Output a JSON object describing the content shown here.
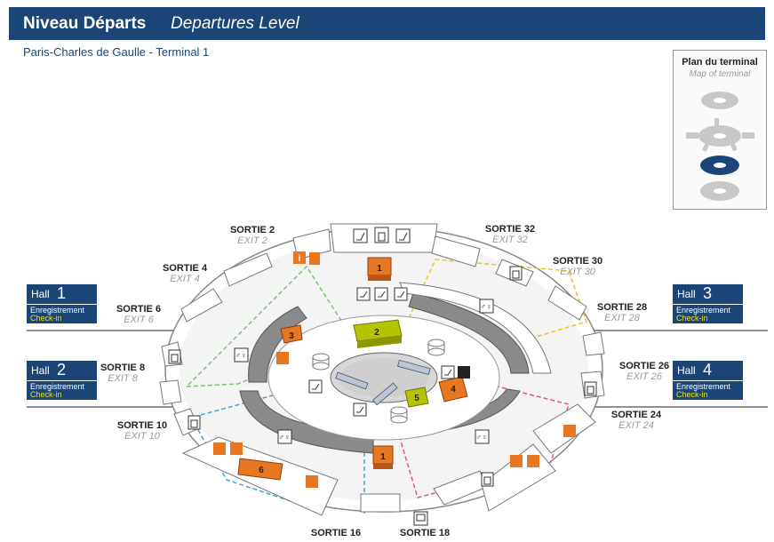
{
  "header": {
    "title_fr": "Niveau Départs",
    "title_en": "Departures Level"
  },
  "subtitle": "Paris-Charles de Gaulle - Terminal 1",
  "plan": {
    "title": "Plan du terminal",
    "subtitle": "Map of terminal"
  },
  "halls": [
    {
      "label": "Hall",
      "number": "1",
      "enregistrement": "Enregistrement",
      "checkin": "Check-in"
    },
    {
      "label": "Hall",
      "number": "2",
      "enregistrement": "Enregistrement",
      "checkin": "Check-in"
    },
    {
      "label": "Hall",
      "number": "3",
      "enregistrement": "Enregistrement",
      "checkin": "Check-in"
    },
    {
      "label": "Hall",
      "number": "4",
      "enregistrement": "Enregistrement",
      "checkin": "Check-in"
    }
  ],
  "exits": {
    "s2": {
      "fr": "SORTIE 2",
      "en": "EXIT 2"
    },
    "s4": {
      "fr": "SORTIE 4",
      "en": "EXIT 4"
    },
    "s6": {
      "fr": "SORTIE 6",
      "en": "EXIT 6"
    },
    "s8": {
      "fr": "SORTIE 8",
      "en": "EXIT 8"
    },
    "s10": {
      "fr": "SORTIE 10",
      "en": "EXIT 10"
    },
    "s16": {
      "fr": "SORTIE 16"
    },
    "s18": {
      "fr": "SORTIE 18"
    },
    "s24": {
      "fr": "SORTIE 24",
      "en": "EXIT 24"
    },
    "s26": {
      "fr": "SORTIE 26",
      "en": "EXIT 26"
    },
    "s28": {
      "fr": "SORTIE 28",
      "en": "EXIT 28"
    },
    "s30": {
      "fr": "SORTIE 30",
      "en": "EXIT 30"
    },
    "s32": {
      "fr": "SORTIE 32",
      "en": "EXIT 32"
    }
  },
  "zones": {
    "z1a": "1",
    "z1b": "1",
    "z2": "2",
    "z3": "3",
    "z4": "4",
    "z5": "5",
    "z6": "6"
  },
  "colors": {
    "navy": "#1b4576",
    "orange": "#e87722",
    "lime": "#b5c400",
    "yellow_path": "#f0c419",
    "green_path": "#7cc576",
    "blue_path": "#3aa8d8",
    "pink_path": "#e0509b",
    "checkin_text": "#e8e028"
  },
  "icons": [
    "escalator-icon",
    "elevator-icon",
    "toilets-icon",
    "information-icon",
    "bus-icon",
    "baggage-icon",
    "atm-icon"
  ]
}
